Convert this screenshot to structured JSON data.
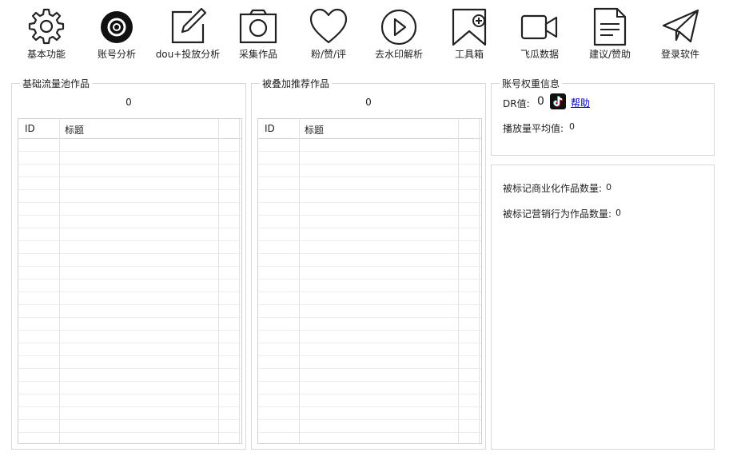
{
  "toolbar": {
    "items": [
      {
        "label": "基本功能",
        "icon": "gear-icon"
      },
      {
        "label": "账号分析",
        "icon": "target-icon"
      },
      {
        "label": "dou+投放分析",
        "icon": "edit-icon"
      },
      {
        "label": "采集作品",
        "icon": "camera-icon"
      },
      {
        "label": "粉/赞/评",
        "icon": "heart-icon"
      },
      {
        "label": "去水印解析",
        "icon": "play-icon"
      },
      {
        "label": "工具箱",
        "icon": "bookmark-add-icon"
      },
      {
        "label": "飞瓜数据",
        "icon": "video-camera-icon"
      },
      {
        "label": "建议/赞助",
        "icon": "document-icon"
      },
      {
        "label": "登录软件",
        "icon": "paper-plane-icon"
      }
    ]
  },
  "basic_pool": {
    "title": "基础流量池作品",
    "count": "0",
    "columns": [
      "ID",
      "标题"
    ]
  },
  "recommend_pool": {
    "title": "被叠加推荐作品",
    "count": "0",
    "columns": [
      "ID",
      "标题"
    ]
  },
  "account_weight": {
    "title": "账号权重信息",
    "dr_label": "DR值:",
    "dr_value": "0",
    "help_label": "帮助",
    "avg_play_label": "播放量平均值:",
    "avg_play_value": "0"
  },
  "marks": {
    "commercial_label": "被标记商业化作品数量:",
    "commercial_value": "0",
    "marketing_label": "被标记营销行为作品数量:",
    "marketing_value": "0"
  }
}
